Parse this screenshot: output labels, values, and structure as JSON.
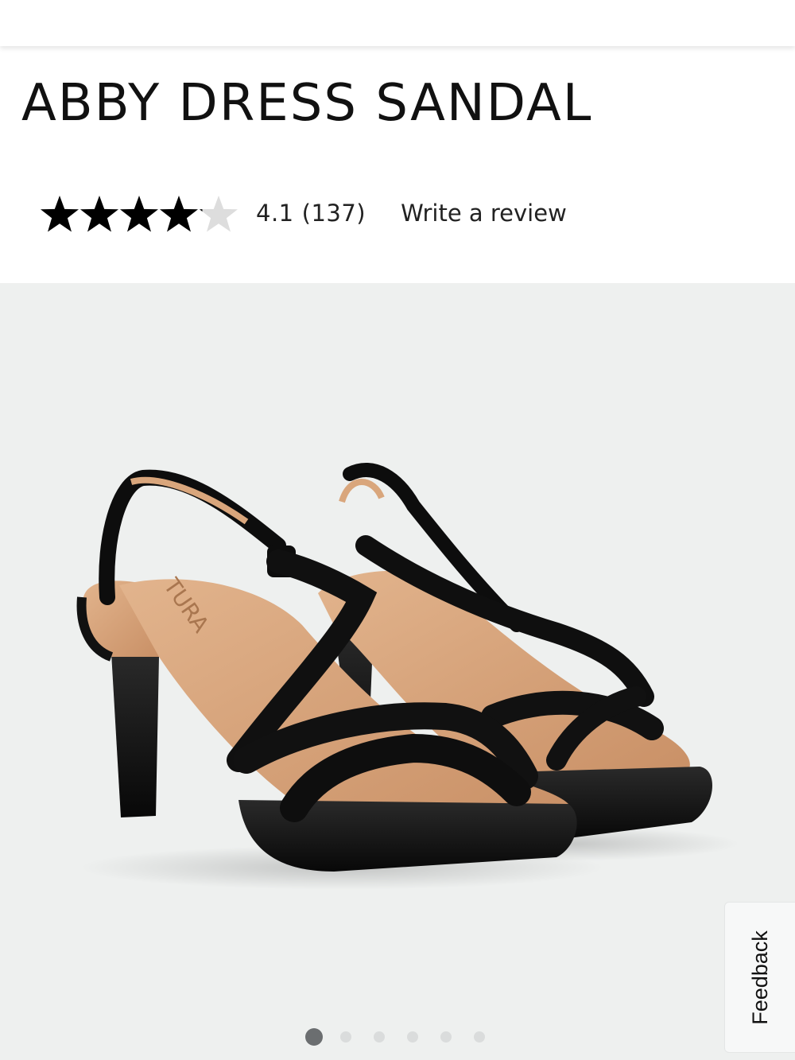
{
  "product": {
    "title": "ABBY DRESS SANDAL"
  },
  "rating": {
    "score": "4.1",
    "count": "(137)",
    "value_out_of_5": 4.1,
    "star_color": "#000000",
    "empty_star_color": "#dddddd",
    "write_review_label": "Write a review"
  },
  "gallery": {
    "background_color": "#eef0ef",
    "image_subject": "pair of black strappy platform dress sandals",
    "total_images": 6,
    "active_index": 0
  },
  "feedback": {
    "label": "Feedback"
  }
}
